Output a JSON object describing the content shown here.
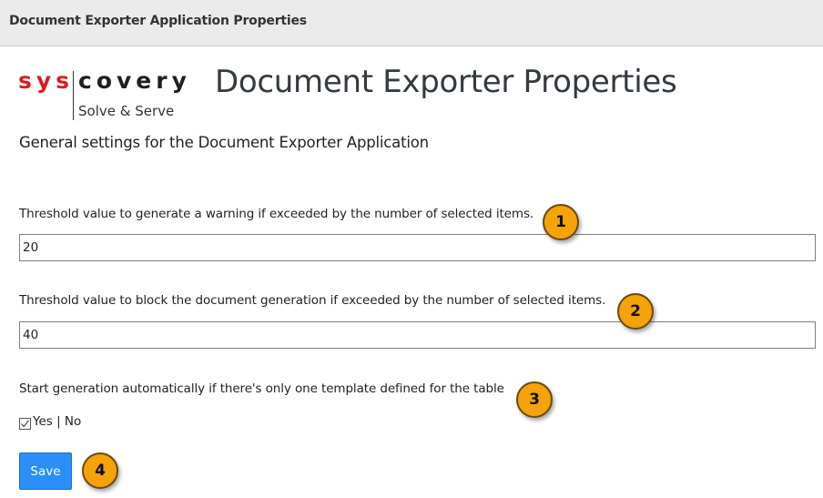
{
  "window": {
    "title": "Document Exporter Application Properties"
  },
  "logo": {
    "brand_part1": "sys",
    "brand_part2": "covery",
    "tagline": "Solve & Serve"
  },
  "page": {
    "title": "Document Exporter Properties",
    "subtitle": "General settings for the Document Exporter Application"
  },
  "fields": {
    "warning_threshold": {
      "label": "Threshold value to generate a warning if exceeded by the number of selected items.",
      "value": "20"
    },
    "block_threshold": {
      "label": "Threshold value to block the document generation if exceeded by the number of selected items.",
      "value": "40"
    },
    "auto_start": {
      "label": "Start generation automatically if there's only one template defined for the table",
      "checkbox_label": "Yes | No",
      "checked": true
    }
  },
  "actions": {
    "save_label": "Save"
  },
  "markers": [
    "1",
    "2",
    "3",
    "4"
  ],
  "colors": {
    "brand_red": "#d81e1e",
    "save_button": "#2b8ff7",
    "marker": "#f5a20b",
    "titlebar": "#ebebeb"
  }
}
